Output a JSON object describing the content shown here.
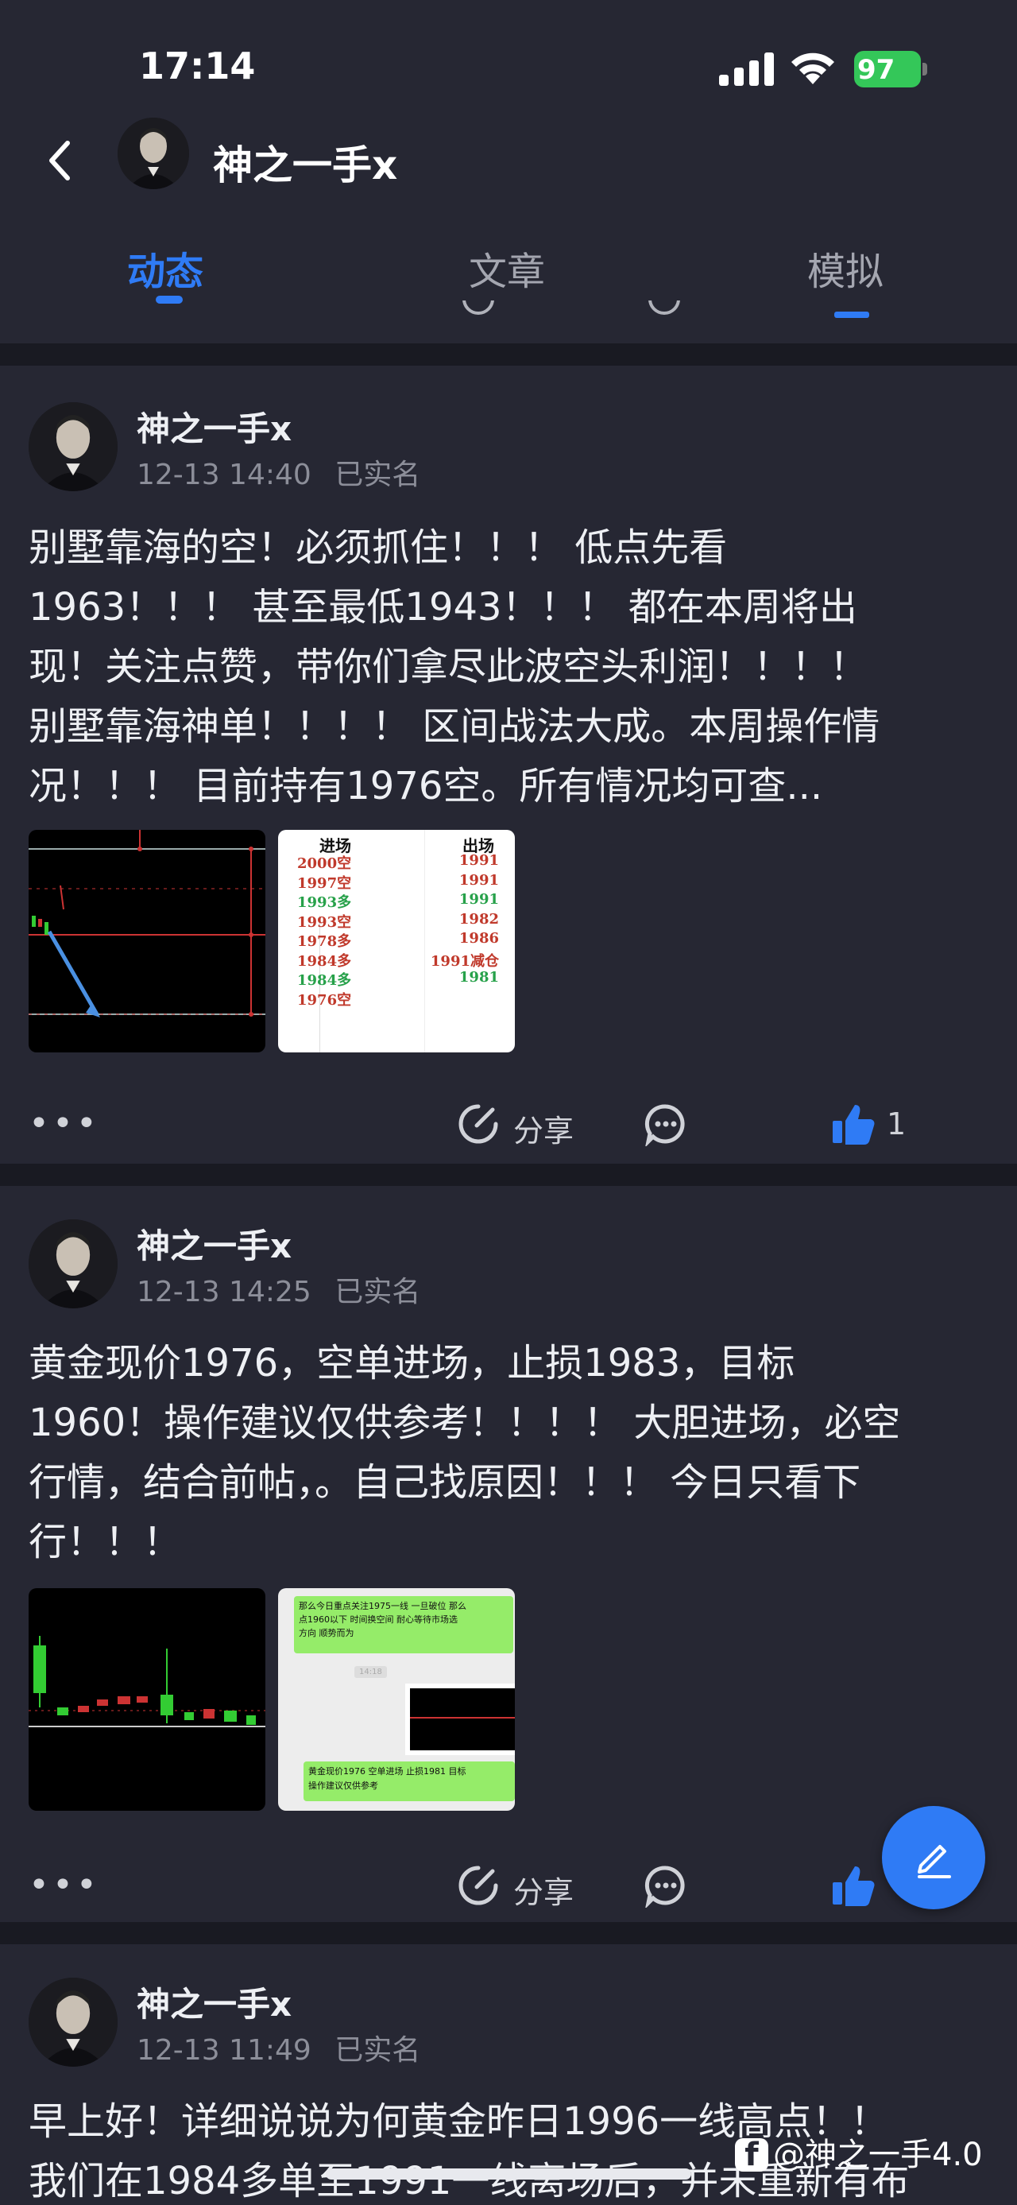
{
  "status_bar": {
    "time": "17:14",
    "battery": "97"
  },
  "header": {
    "name": "神之一手x"
  },
  "tabs": [
    {
      "label": "动态",
      "active": true
    },
    {
      "label": "文章",
      "active": false
    },
    {
      "label": "模拟",
      "active": false
    }
  ],
  "posts": [
    {
      "author": "神之一手x",
      "datetime": "12-13 14:40",
      "verified": "已实名",
      "lines": [
        "别墅靠海的空！必须抓住！！！ 低点先看",
        "1963！！！ 甚至最低1943！！！ 都在本周将出",
        "现！关注点赞，带你们拿尽此波空头利润！！！！",
        "别墅靠海神单！！！！ 区间战法大成。本周操作情",
        "况！！！ 目前持有1976空。所有情况均可查..."
      ],
      "table": {
        "headers": [
          "进场",
          "出场"
        ],
        "rows": [
          {
            "in": "2000空",
            "out": "1991",
            "in_color": "#c0392b",
            "out_color": "#c0392b"
          },
          {
            "in": "1997空",
            "out": "1991",
            "in_color": "#c0392b",
            "out_color": "#c0392b"
          },
          {
            "in": "1993多",
            "out": "1991",
            "in_color": "#27a14a",
            "out_color": "#27a14a"
          },
          {
            "in": "1993空",
            "out": "1982",
            "in_color": "#c0392b",
            "out_color": "#c0392b"
          },
          {
            "in": "1978多",
            "out": "1986",
            "in_color": "#c0392b",
            "out_color": "#c0392b"
          },
          {
            "in": "1984多",
            "out": "1991减仓",
            "in_color": "#c0392b",
            "out_color": "#c0392b"
          },
          {
            "in": "1984多",
            "out": "1981",
            "in_color": "#27a14a",
            "out_color": "#27a14a"
          },
          {
            "in": "1976空",
            "out": "",
            "in_color": "#c0392b",
            "out_color": "#c0392b"
          }
        ]
      },
      "share_label": "分享",
      "like_count": "1"
    },
    {
      "author": "神之一手x",
      "datetime": "12-13 14:25",
      "verified": "已实名",
      "lines": [
        "黄金现价1976，空单进场，止损1983，目标",
        "1960！操作建议仅供参考！！！！ 大胆进场，必空",
        "行情，结合前帖，。自己找原因！！！ 今日只看下",
        "行！！！"
      ],
      "chat": {
        "msg1_line1": "那么今日重点关注1975一线  一旦破位  那么",
        "msg1_line2": "点1960以下    时间换空间    耐心等待市场选",
        "msg1_line3": "方向  顺势而为",
        "time": "14:18",
        "msg2_line1": "黄金现价1976  空单进场  止损1981  目标",
        "msg2_line2": "操作建议仅供参考"
      },
      "share_label": "分享",
      "like_count": ""
    },
    {
      "author": "神之一手x",
      "datetime": "12-13 11:49",
      "verified": "已实名",
      "lines": [
        "早上好！详细说说为何黄金昨日1996一线高点！！",
        "我们在1984多单至1991一线离场后，并未重新有布"
      ]
    }
  ],
  "watermark": {
    "badge": "f",
    "text": "@神之一手4.0"
  }
}
